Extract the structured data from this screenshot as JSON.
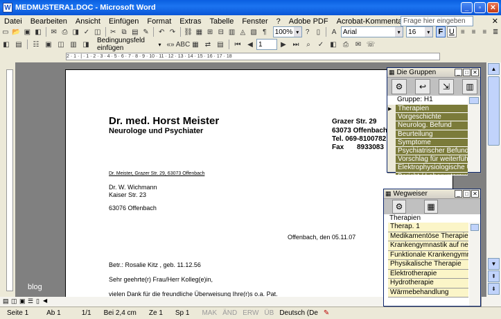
{
  "window": {
    "title": "MEDMUSTERA1.DOC - Microsoft Word",
    "app_icon": "W"
  },
  "menu": [
    "Datei",
    "Bearbeiten",
    "Ansicht",
    "Einfügen",
    "Format",
    "Extras",
    "Tabelle",
    "Fenster",
    "?",
    "Adobe PDF",
    "Acrobat-Kommentare"
  ],
  "help_placeholder": "Frage hier eingeben",
  "toolbar": {
    "zoom": "100%",
    "font": "Arial",
    "size": "16",
    "bold": "F",
    "underline": "U",
    "field_combo": "Bedingungsfeld einfügen",
    "record_no": "1"
  },
  "ruler_text": "2 · 1 · | · 1 · 2 · 3 · 4 · 5 · 6 · 7 · 8 · 9 · 10 · 11 · 12 · 13 · 14 · 15 · 16 · 17 · 18",
  "letter": {
    "doctor_name": "Dr. med. Horst Meister",
    "specialty": "Neurologe und Psychiater",
    "address_street": "Grazer Str. 29",
    "address_city": "63073 Offenbach",
    "phone": "Tel. 069-8100782",
    "fax_label": "Fax",
    "fax_number": "8933083",
    "sender_line": "Dr. Meister, Grazer Str. 29, 63073 Offenbach",
    "recipient_name": "Dr. W. Wichmann",
    "recipient_street": "Kaiser Str. 23",
    "recipient_city": "63076 Offenbach",
    "date_line": "Offenbach, den 05.11.07",
    "subject": "Betr.: Rosalie Kitz , geb. 11.12.56",
    "salutation": "Sehr geehrte(r) Frau/Herr Kolleg(e)in,",
    "body": "vielen Dank für die freundliche Überweisung Ihre(r)s o.a. Pat."
  },
  "panel_groups": {
    "title": "Die Gruppen",
    "header": "Gruppe: H1",
    "items": [
      "Therapien",
      "Vorgeschichte",
      "Neurolog. Befund",
      "Beurteilung",
      "Symptome",
      "Psychiatrischer Befund",
      "Vorschlag für weiterführende",
      "Elektrophysiologische Unt",
      "Bericht / Laboruntersuchung"
    ]
  },
  "panel_wegweiser": {
    "title": "Wegweiser",
    "header": "Therapien",
    "items": [
      "Therap. 1",
      "Medikamentöse Therapie",
      "Krankengymnastik auf neurop",
      "Funktionale Krankengymnastik",
      "Physikalische Therapie",
      "Elektrotherapie",
      "Hydrotherapie",
      "Wärmebehandlung"
    ]
  },
  "status": {
    "page": "Seite 1",
    "section": "Ab 1",
    "pages": "1/1",
    "at": "Bei 2,4 cm",
    "line": "Ze 1",
    "col": "Sp 1",
    "mak": "MAK",
    "aend": "ÄND",
    "erw": "ERW",
    "ueb": "ÜB",
    "lang": "Deutsch (De"
  },
  "watermark": "blog",
  "colors": {
    "titlebar": "#0a5fe0",
    "olive": "#7b7b3a",
    "cream": "#fbf5c8"
  }
}
